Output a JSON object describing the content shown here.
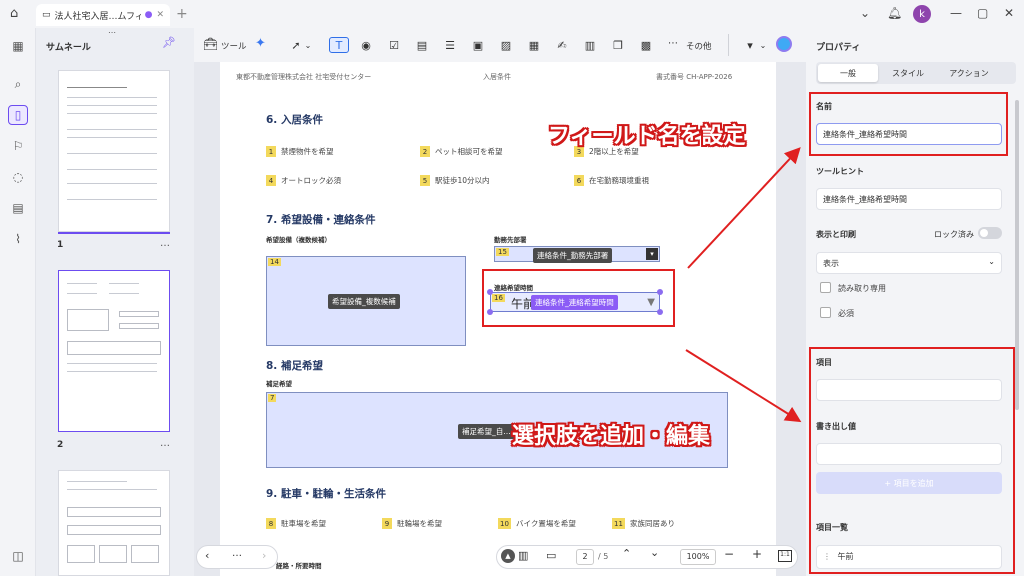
{
  "titlebar": {
    "tab_title": "法人社宅入居…ムフィールド",
    "avatar_letter": "k"
  },
  "thumbnails": {
    "title": "サムネール",
    "pages": [
      "1",
      "2"
    ],
    "more": "…"
  },
  "toolbar": {
    "tool_label": "ツール",
    "more_label": "その他"
  },
  "document": {
    "header_left": "東都不動産管理株式会社 社宅受付センター",
    "header_center": "入居条件",
    "header_right": "書式番号 CH-APP-2026",
    "sec6_title": "6. 入居条件",
    "sec6_items": [
      {
        "n": "1",
        "t": "禁煙物件を希望"
      },
      {
        "n": "2",
        "t": "ペット相談可を希望"
      },
      {
        "n": "3",
        "t": "2階以上を希望"
      },
      {
        "n": "4",
        "t": "オートロック必須"
      },
      {
        "n": "5",
        "t": "駅徒歩10分以内"
      },
      {
        "n": "6",
        "t": "在宅勤務環境重視"
      }
    ],
    "sec7_title": "7. 希望設備・連絡条件",
    "equip_label": "希望設備（複数候補）",
    "equip_num": "14",
    "equip_tip": "希望設備_複数候補",
    "dept_label": "勤務先部署",
    "dept_num": "15",
    "dept_tip": "連絡条件_勤務先部署",
    "time_label": "連絡希望時間",
    "time_num": "16",
    "time_value": "午前",
    "time_tip": "連絡条件_連絡希望時間",
    "sec8_title": "8. 補足希望",
    "supp_label": "補足希望",
    "supp_num": "7",
    "supp_tip": "補足希望_自…",
    "sec9_title": "9. 駐車・駐輪・生活条件",
    "sec9_items": [
      {
        "n": "8",
        "t": "駐車場を希望"
      },
      {
        "n": "9",
        "t": "駐輪場を希望"
      },
      {
        "n": "10",
        "t": "バイク置場を希望"
      },
      {
        "n": "11",
        "t": "家族同居あり"
      }
    ],
    "bottom_cut": "経路・所要時間"
  },
  "callouts": {
    "top": "フィールド名を設定",
    "bottom": "選択肢を追加・編集"
  },
  "bottombar": {
    "page_current": "2",
    "page_total": "/ 5",
    "zoom": "100%",
    "more": "…"
  },
  "properties": {
    "title": "プロパティ",
    "tabs": [
      "一般",
      "スタイル",
      "アクション"
    ],
    "name_label": "名前",
    "name_value": "連絡条件_連絡希望時間",
    "tooltip_label": "ツールヒント",
    "tooltip_value": "連絡条件_連絡希望時間",
    "display_label": "表示と印刷",
    "locked_label": "ロック済み",
    "display_value": "表示",
    "readonly_label": "読み取り専用",
    "required_label": "必須",
    "item_label": "項目",
    "item_value": "",
    "export_label": "書き出し値",
    "export_value": "",
    "add_button": "+ 項目を追加",
    "list_label": "項目一覧",
    "list_items": [
      "午前"
    ]
  },
  "colors": {
    "accent": "#6c4cf0",
    "annotation_red": "#e02020",
    "field_fill": "#dde3ff"
  }
}
